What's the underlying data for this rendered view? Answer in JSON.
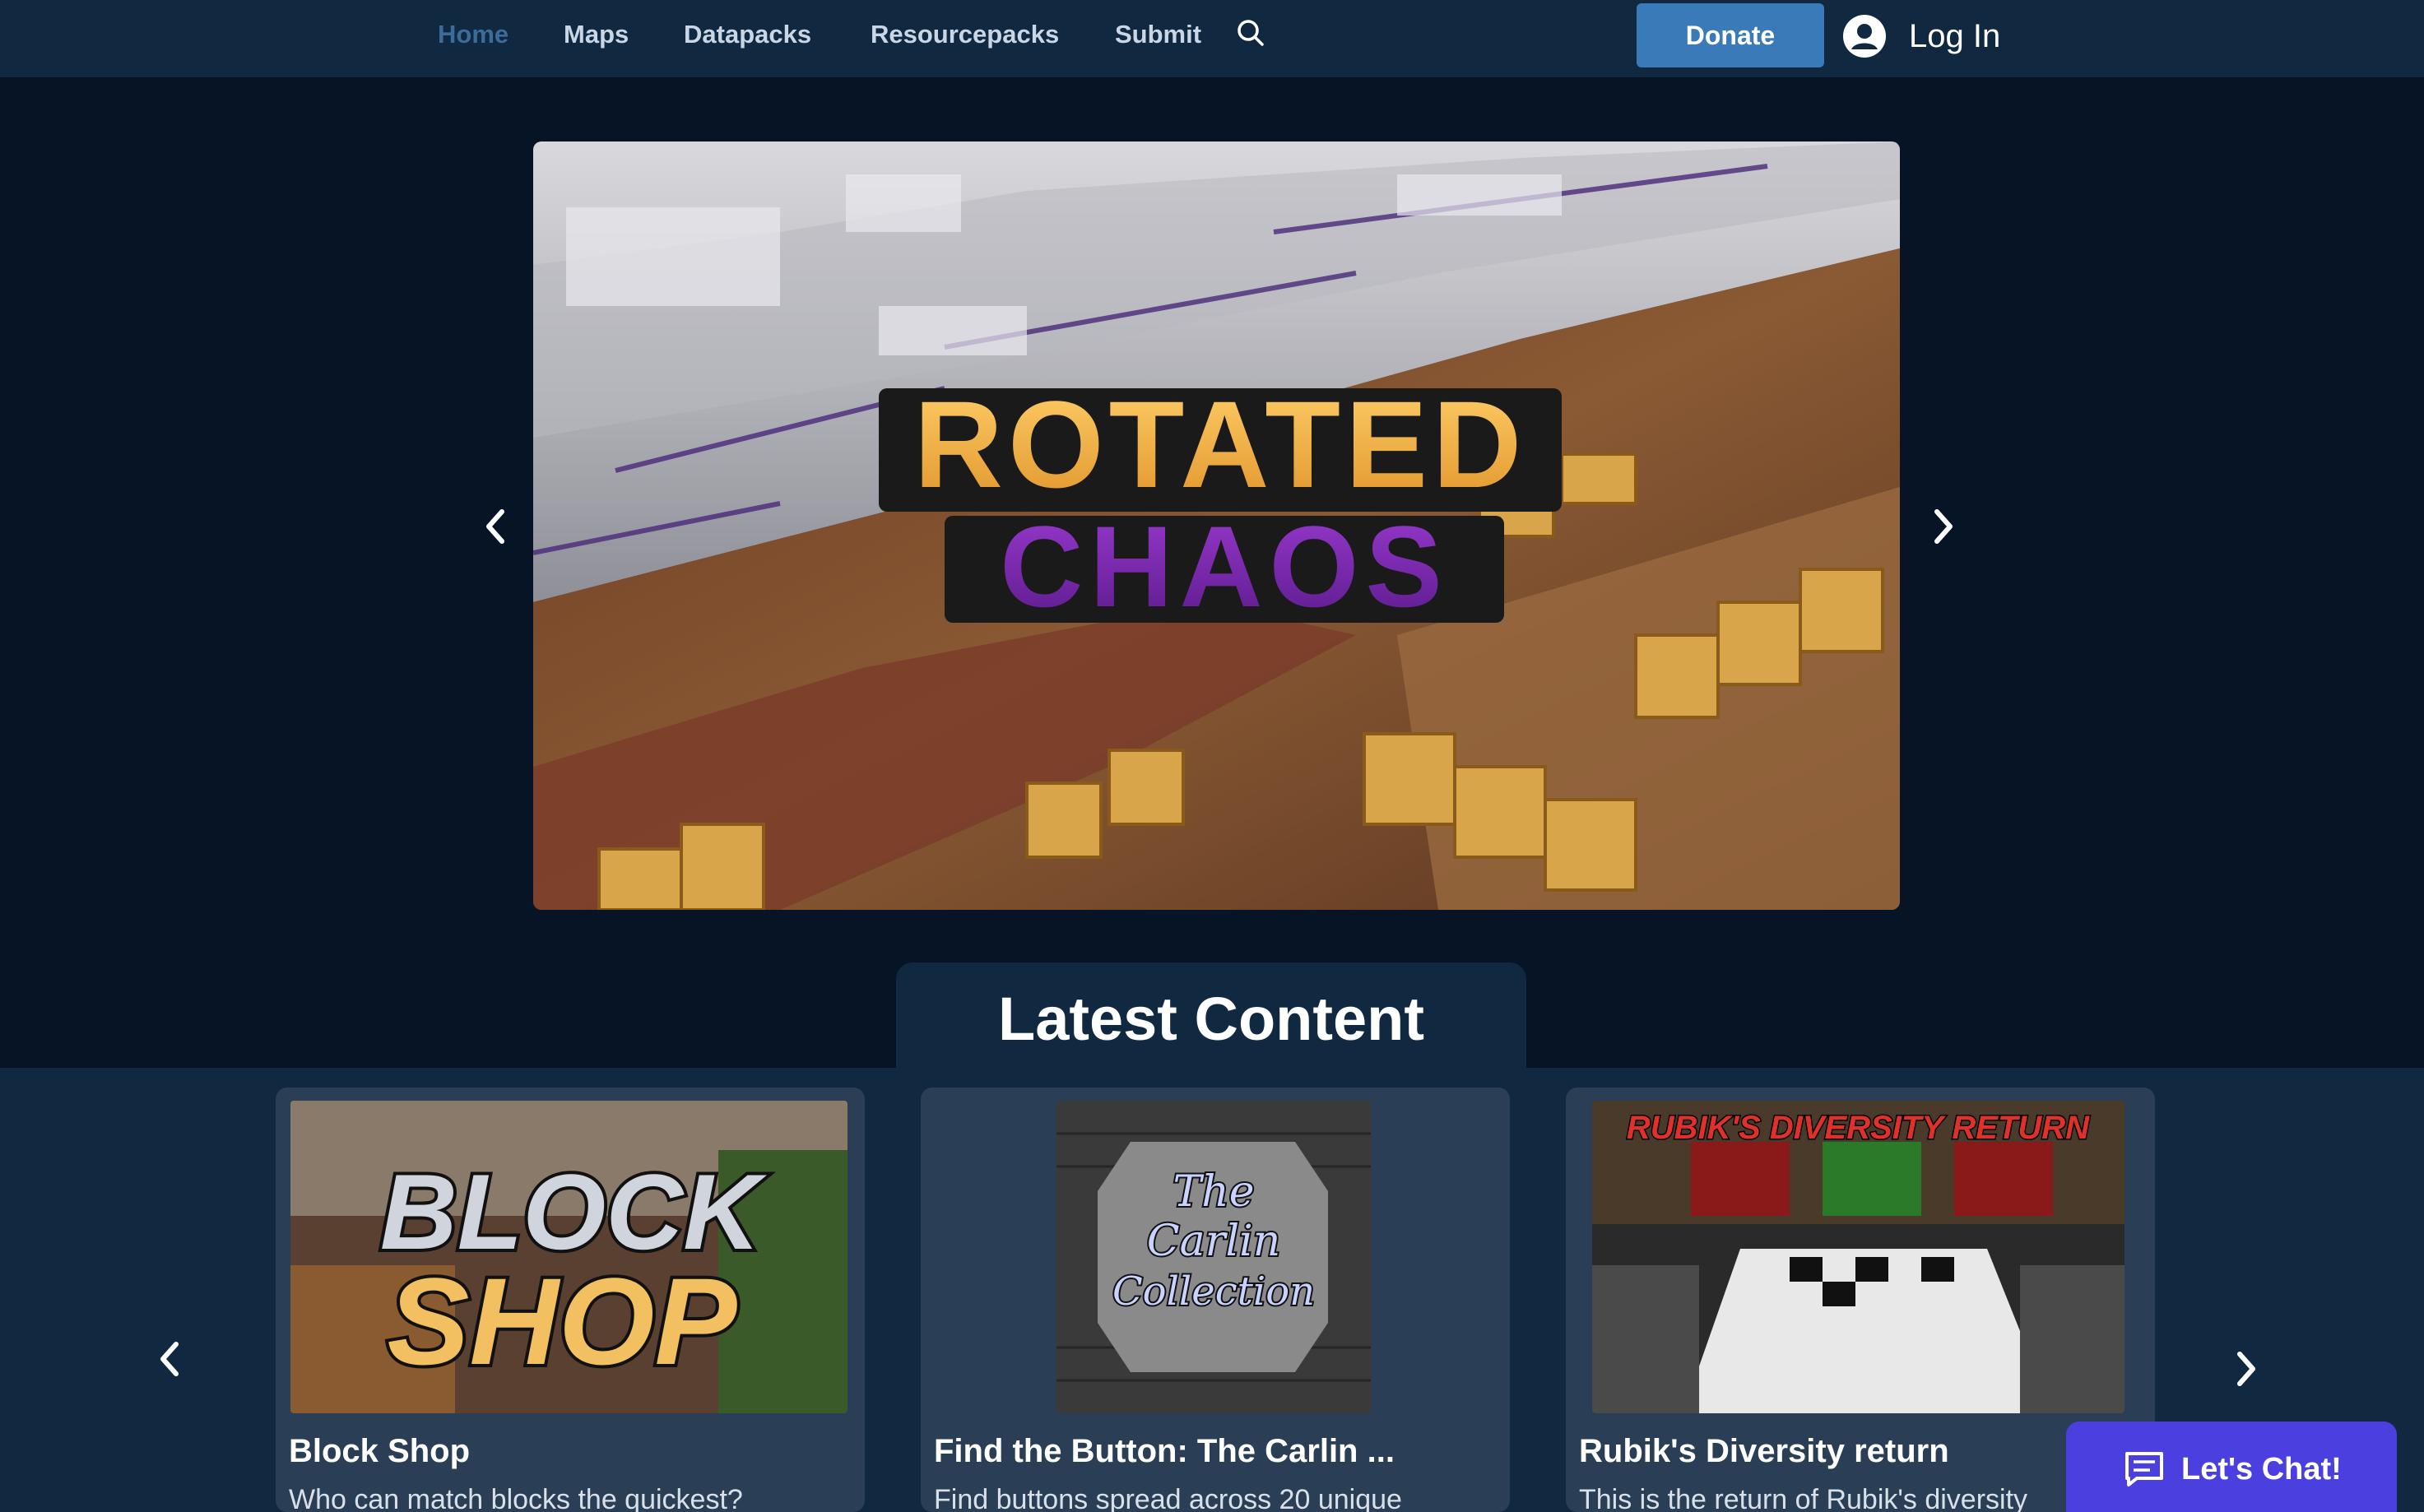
{
  "nav": {
    "items": [
      {
        "label": "Home",
        "active": true
      },
      {
        "label": "Maps"
      },
      {
        "label": "Datapacks"
      },
      {
        "label": "Resourcepacks"
      },
      {
        "label": "Submit"
      }
    ],
    "search_icon": "search-icon",
    "donate_label": "Donate",
    "login_label": "Log In"
  },
  "hero": {
    "logo_line1": "ROTATED",
    "logo_line2": "CHAOS",
    "prev_icon": "chevron-left-icon",
    "next_icon": "chevron-right-icon"
  },
  "latest": {
    "title": "Latest Content",
    "cards": [
      {
        "thumb_line1": "BLOCK",
        "thumb_line2": "SHOP",
        "title": "Block Shop",
        "description": "Who can match blocks the quickest?"
      },
      {
        "thumb_line1": "The",
        "thumb_line2": "Carlin",
        "thumb_line3": "Collection",
        "title": "Find the Button: The Carlin ...",
        "description": "Find buttons spread across 20 unique"
      },
      {
        "thumb_line1": "RUBIK'S DIVERSITY RETURN",
        "title": "Rubik's Diversity return",
        "description": "This is the return of Rubik's diversity"
      }
    ]
  },
  "chat": {
    "label": "Let's Chat!",
    "icon": "chat-bubble-icon"
  },
  "colors": {
    "background": "#061426",
    "header": "#102840",
    "accent": "#3a7ab8",
    "chat": "#4b3fe0",
    "active_nav": "#3c6c9a"
  }
}
